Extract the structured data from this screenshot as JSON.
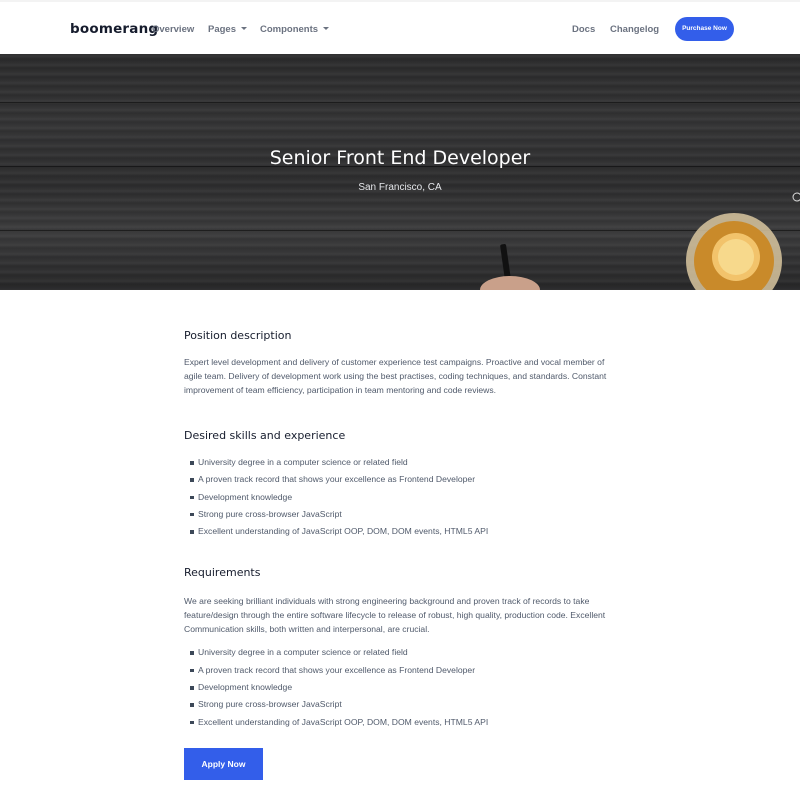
{
  "navbar": {
    "brand": "boomerang",
    "links": {
      "overview": "Overview",
      "pages": "Pages",
      "components": "Components",
      "docs": "Docs",
      "changelog": "Changelog"
    },
    "purchase_label": "Purchase Now"
  },
  "hero": {
    "title": "Senior Front End Developer",
    "location": "San Francisco, CA"
  },
  "sections": {
    "position": {
      "title": "Position description",
      "text": "Expert level development and delivery of customer experience test campaigns. Proactive and vocal member of agile team. Delivery of development work using the best practises, coding techniques, and standards. Constant improvement of team efficiency, participation in team mentoring and code reviews."
    },
    "skills": {
      "title": "Desired skills and experience",
      "items": [
        "University degree in a computer science or related field",
        "A proven track record that shows your excellence as Frontend Developer",
        "Development knowledge",
        "Strong pure cross-browser JavaScript",
        "Excellent understanding of JavaScript OOP, DOM, DOM events, HTML5 API"
      ]
    },
    "requirements": {
      "title": "Requirements",
      "text": "We are seeking brilliant individuals with strong engineering background and proven track of records to take feature/design through the entire software lifecycle to release of robust, high quality, production code. Excellent Communication skills, both written and interpersonal, are crucial.",
      "items": [
        "University degree in a computer science or related field",
        "A proven track record that shows your excellence as Frontend Developer",
        "Development knowledge",
        "Strong pure cross-browser JavaScript",
        "Excellent understanding of JavaScript OOP, DOM, DOM events, HTML5 API"
      ]
    }
  },
  "apply_label": "Apply Now",
  "colors": {
    "primary": "#335eea",
    "heading": "#161c2d",
    "body_text": "#505a6b",
    "hero_bg": "#2f2f30"
  }
}
